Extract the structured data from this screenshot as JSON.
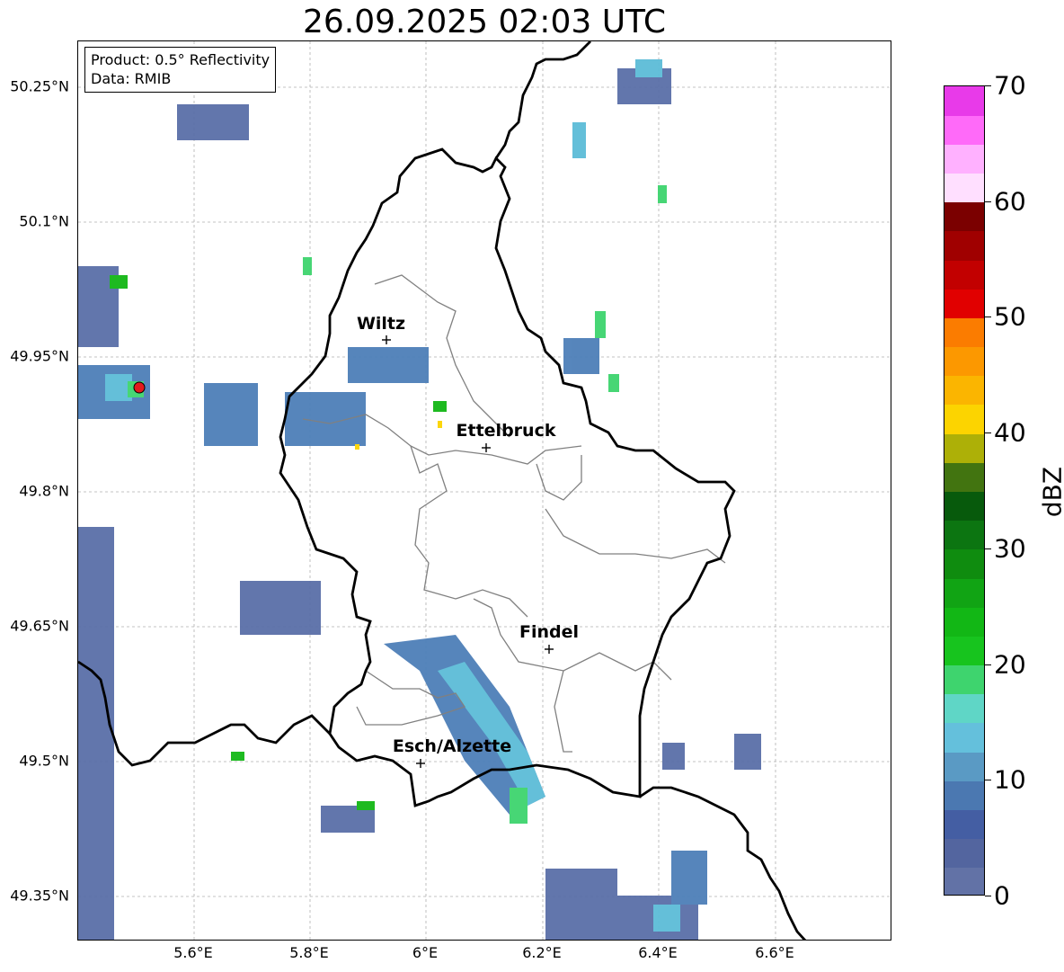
{
  "title": "26.09.2025 02:03 UTC",
  "info_box": {
    "product": "Product: 0.5° Reflectivity",
    "data": "Data: RMIB"
  },
  "lat_labels": [
    "50.25°N",
    "50.1°N",
    "49.95°N",
    "49.8°N",
    "49.65°N",
    "49.5°N",
    "49.35°N"
  ],
  "lon_labels": [
    "5.6°E",
    "5.8°E",
    "6°E",
    "6.2°E",
    "6.4°E",
    "6.6°E"
  ],
  "cities": [
    {
      "name": "Wiltz"
    },
    {
      "name": "Ettelbruck"
    },
    {
      "name": "Findel"
    },
    {
      "name": "Esch/Alzette"
    }
  ],
  "colorbar": {
    "unit": "dBZ",
    "ticks": [
      "0",
      "10",
      "20",
      "30",
      "40",
      "50",
      "60",
      "70"
    ],
    "colors": [
      "#6272a6",
      "#53659f",
      "#445ea3",
      "#4b78b1",
      "#5a9ac4",
      "#64c0dc",
      "#5fd6c6",
      "#3ed46e",
      "#17c41e",
      "#12b715",
      "#11a414",
      "#0f8c0f",
      "#0c7511",
      "#075a0c",
      "#427410",
      "#adb007",
      "#fcd400",
      "#fbb500",
      "#fc9800",
      "#fb7c00",
      "#e10000",
      "#c20000",
      "#a00000",
      "#7b0000",
      "#ffdfff",
      "#ffb1ff",
      "#ff6af9",
      "#e83ae9"
    ]
  },
  "colors": {
    "border_country": "#000000",
    "border_canton": "#808080",
    "radar_site": "#e31a1c"
  }
}
